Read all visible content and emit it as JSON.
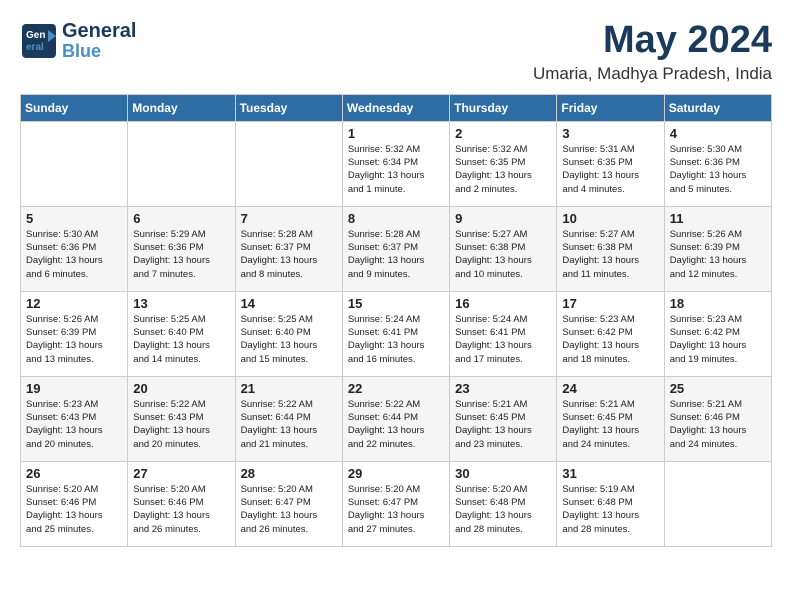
{
  "logo": {
    "line1": "General",
    "line2": "Blue"
  },
  "title": "May 2024",
  "subtitle": "Umaria, Madhya Pradesh, India",
  "headers": [
    "Sunday",
    "Monday",
    "Tuesday",
    "Wednesday",
    "Thursday",
    "Friday",
    "Saturday"
  ],
  "weeks": [
    [
      {
        "day": "",
        "content": ""
      },
      {
        "day": "",
        "content": ""
      },
      {
        "day": "",
        "content": ""
      },
      {
        "day": "1",
        "content": "Sunrise: 5:32 AM\nSunset: 6:34 PM\nDaylight: 13 hours\nand 1 minute."
      },
      {
        "day": "2",
        "content": "Sunrise: 5:32 AM\nSunset: 6:35 PM\nDaylight: 13 hours\nand 2 minutes."
      },
      {
        "day": "3",
        "content": "Sunrise: 5:31 AM\nSunset: 6:35 PM\nDaylight: 13 hours\nand 4 minutes."
      },
      {
        "day": "4",
        "content": "Sunrise: 5:30 AM\nSunset: 6:36 PM\nDaylight: 13 hours\nand 5 minutes."
      }
    ],
    [
      {
        "day": "5",
        "content": "Sunrise: 5:30 AM\nSunset: 6:36 PM\nDaylight: 13 hours\nand 6 minutes."
      },
      {
        "day": "6",
        "content": "Sunrise: 5:29 AM\nSunset: 6:36 PM\nDaylight: 13 hours\nand 7 minutes."
      },
      {
        "day": "7",
        "content": "Sunrise: 5:28 AM\nSunset: 6:37 PM\nDaylight: 13 hours\nand 8 minutes."
      },
      {
        "day": "8",
        "content": "Sunrise: 5:28 AM\nSunset: 6:37 PM\nDaylight: 13 hours\nand 9 minutes."
      },
      {
        "day": "9",
        "content": "Sunrise: 5:27 AM\nSunset: 6:38 PM\nDaylight: 13 hours\nand 10 minutes."
      },
      {
        "day": "10",
        "content": "Sunrise: 5:27 AM\nSunset: 6:38 PM\nDaylight: 13 hours\nand 11 minutes."
      },
      {
        "day": "11",
        "content": "Sunrise: 5:26 AM\nSunset: 6:39 PM\nDaylight: 13 hours\nand 12 minutes."
      }
    ],
    [
      {
        "day": "12",
        "content": "Sunrise: 5:26 AM\nSunset: 6:39 PM\nDaylight: 13 hours\nand 13 minutes."
      },
      {
        "day": "13",
        "content": "Sunrise: 5:25 AM\nSunset: 6:40 PM\nDaylight: 13 hours\nand 14 minutes."
      },
      {
        "day": "14",
        "content": "Sunrise: 5:25 AM\nSunset: 6:40 PM\nDaylight: 13 hours\nand 15 minutes."
      },
      {
        "day": "15",
        "content": "Sunrise: 5:24 AM\nSunset: 6:41 PM\nDaylight: 13 hours\nand 16 minutes."
      },
      {
        "day": "16",
        "content": "Sunrise: 5:24 AM\nSunset: 6:41 PM\nDaylight: 13 hours\nand 17 minutes."
      },
      {
        "day": "17",
        "content": "Sunrise: 5:23 AM\nSunset: 6:42 PM\nDaylight: 13 hours\nand 18 minutes."
      },
      {
        "day": "18",
        "content": "Sunrise: 5:23 AM\nSunset: 6:42 PM\nDaylight: 13 hours\nand 19 minutes."
      }
    ],
    [
      {
        "day": "19",
        "content": "Sunrise: 5:23 AM\nSunset: 6:43 PM\nDaylight: 13 hours\nand 20 minutes."
      },
      {
        "day": "20",
        "content": "Sunrise: 5:22 AM\nSunset: 6:43 PM\nDaylight: 13 hours\nand 20 minutes."
      },
      {
        "day": "21",
        "content": "Sunrise: 5:22 AM\nSunset: 6:44 PM\nDaylight: 13 hours\nand 21 minutes."
      },
      {
        "day": "22",
        "content": "Sunrise: 5:22 AM\nSunset: 6:44 PM\nDaylight: 13 hours\nand 22 minutes."
      },
      {
        "day": "23",
        "content": "Sunrise: 5:21 AM\nSunset: 6:45 PM\nDaylight: 13 hours\nand 23 minutes."
      },
      {
        "day": "24",
        "content": "Sunrise: 5:21 AM\nSunset: 6:45 PM\nDaylight: 13 hours\nand 24 minutes."
      },
      {
        "day": "25",
        "content": "Sunrise: 5:21 AM\nSunset: 6:46 PM\nDaylight: 13 hours\nand 24 minutes."
      }
    ],
    [
      {
        "day": "26",
        "content": "Sunrise: 5:20 AM\nSunset: 6:46 PM\nDaylight: 13 hours\nand 25 minutes."
      },
      {
        "day": "27",
        "content": "Sunrise: 5:20 AM\nSunset: 6:46 PM\nDaylight: 13 hours\nand 26 minutes."
      },
      {
        "day": "28",
        "content": "Sunrise: 5:20 AM\nSunset: 6:47 PM\nDaylight: 13 hours\nand 26 minutes."
      },
      {
        "day": "29",
        "content": "Sunrise: 5:20 AM\nSunset: 6:47 PM\nDaylight: 13 hours\nand 27 minutes."
      },
      {
        "day": "30",
        "content": "Sunrise: 5:20 AM\nSunset: 6:48 PM\nDaylight: 13 hours\nand 28 minutes."
      },
      {
        "day": "31",
        "content": "Sunrise: 5:19 AM\nSunset: 6:48 PM\nDaylight: 13 hours\nand 28 minutes."
      },
      {
        "day": "",
        "content": ""
      }
    ]
  ]
}
